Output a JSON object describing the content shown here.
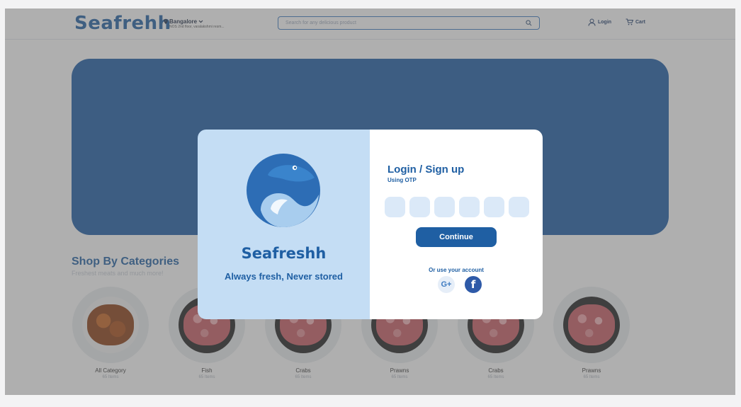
{
  "header": {
    "logo": "Seafrehh",
    "location_city": "Bangalore",
    "location_address": "NOS 2nd floor, varalakshmi resm...",
    "search_placeholder": "Search for any delicious product",
    "login_label": "Login",
    "cart_label": "Cart"
  },
  "categories": {
    "title": "Shop By Categories",
    "subtitle": "Freshest meats and much more!",
    "items": [
      {
        "label": "All Category",
        "count": "65 Items"
      },
      {
        "label": "Fish",
        "count": "65 Items"
      },
      {
        "label": "Crabs",
        "count": "65 Items"
      },
      {
        "label": "Prawns",
        "count": "65 Items"
      },
      {
        "label": "Crabs",
        "count": "65 Items"
      },
      {
        "label": "Prawns",
        "count": "65 Items"
      }
    ]
  },
  "modal": {
    "brand": "Seafreshh",
    "tagline": "Always fresh, Never stored",
    "title": "Login / Sign up",
    "subtitle": "Using OTP",
    "otp_boxes": 6,
    "continue_label": "Continue",
    "alt_label": "Or use your account",
    "google_label": "G+",
    "facebook_label": "f"
  },
  "colors": {
    "brand_blue": "#1f5fa3",
    "modal_left_bg": "#c4ddf4",
    "otp_bg": "#dbe9f8",
    "overlay": "rgba(95,95,95,0.5)"
  }
}
